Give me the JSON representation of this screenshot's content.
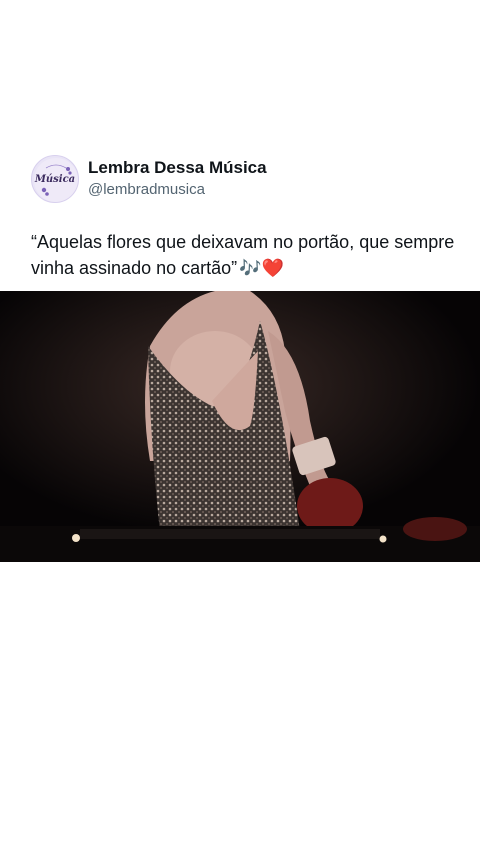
{
  "account": {
    "display_name": "Lembra Dessa Música",
    "handle": "@lembradmusica",
    "avatar_logo_text": "Música",
    "avatar_icon": "music-notes-logo"
  },
  "tweet": {
    "text": "“Aquelas flores que deixavam no portão, que sempre vinha assinado no cartão”",
    "emoji": "🎶❤️"
  },
  "media": {
    "type": "video-frame",
    "description_icon": "video-thumbnail"
  },
  "colors": {
    "background": "#ffffff",
    "text_primary": "#0f1419",
    "text_secondary": "#536471",
    "media_background": "#060405",
    "avatar_background": "#e9e4f6"
  }
}
